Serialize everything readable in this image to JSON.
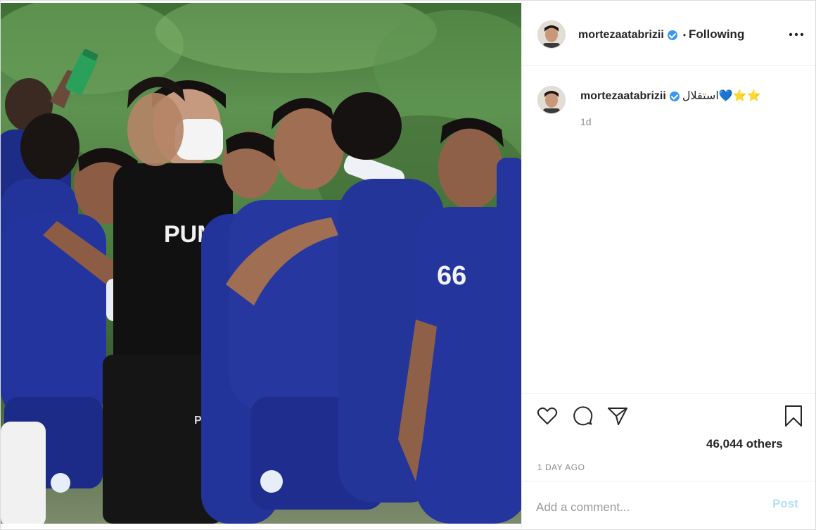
{
  "post": {
    "author": "mortezaatabrizii",
    "follow_status": "Following",
    "caption_text": "استقلال💙⭐⭐",
    "caption_time": "1d",
    "likes_text": "46,044 others",
    "time_ago": "1 DAY AGO"
  },
  "photo": {
    "shirt_brand": "PUMA",
    "shorts_brand": "PUMA",
    "jersey_number": "66"
  },
  "comment": {
    "placeholder": "Add a comment...",
    "post_label": "Post"
  },
  "colors": {
    "link_disabled": "#b2dffc",
    "verified": "#3897f0",
    "muted": "#8e8e8e",
    "kit_blue": "#1f2f8f"
  },
  "icons": {
    "like": "heart-icon",
    "comment": "comment-icon",
    "share": "paper-plane-icon",
    "save": "bookmark-icon",
    "more": "more-options-icon",
    "verified": "verified-badge-icon"
  }
}
